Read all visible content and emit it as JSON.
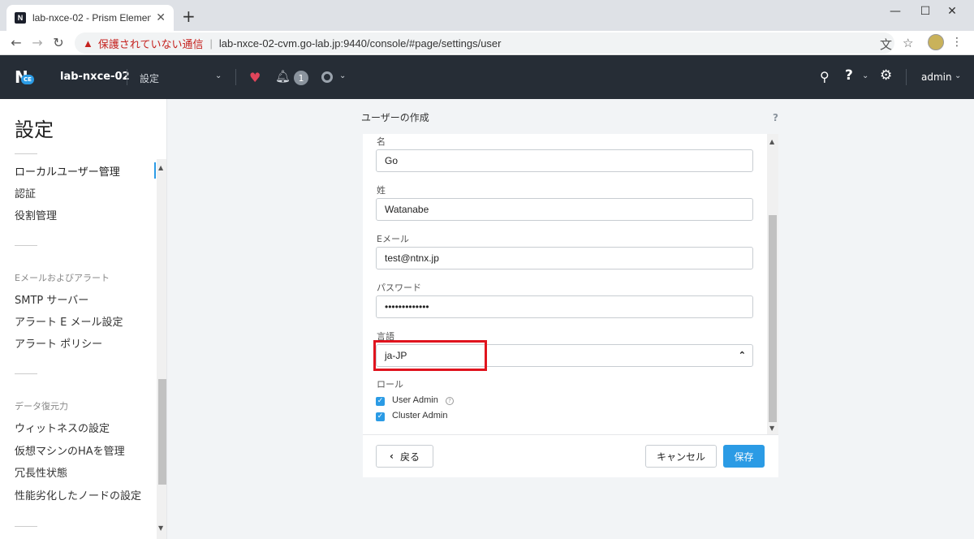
{
  "browser": {
    "tab_title": "lab-nxce-02 - Prism Element",
    "tab_favicon": "N",
    "new_tab": "+",
    "close_tab": "✕",
    "minimize": "—",
    "maximize": "☐",
    "close_window": "✕",
    "back": "←",
    "forward": "→",
    "reload": "↻",
    "security_warning": "保護されていない通信",
    "url": "lab-nxce-02-cvm.go-lab.jp:9440/console/#page/settings/user",
    "icons": [
      "translate-icon",
      "star-icon",
      "profile-icon",
      "menu-icon"
    ]
  },
  "header": {
    "logo_text": "N",
    "logo_badge": "CE",
    "cluster": "lab-nxce-02",
    "page": "設定",
    "alerts_count": "1",
    "user": "admin"
  },
  "sidebar": {
    "title": "設定",
    "items_group1": [
      "ローカルユーザー管理",
      "認証",
      "役割管理"
    ],
    "heading_email": "Eメールおよびアラート",
    "items_group2": [
      "SMTP サーバー",
      "アラート E メール設定",
      "アラート ポリシー"
    ],
    "heading_data": "データ復元力",
    "items_group3": [
      "ウィットネスの設定",
      "仮想マシンのHAを管理",
      "冗長性状態",
      "性能劣化したノードの設定"
    ]
  },
  "dialog": {
    "title": "ユーザーの作成",
    "help": "?",
    "first_name_label": "名",
    "first_name_value": "Go",
    "last_name_label": "姓",
    "last_name_value": "Watanabe",
    "email_label": "Eメール",
    "email_value": "test@ntnx.jp",
    "password_label": "パスワード",
    "password_value": "•••••••••••••",
    "language_label": "言語",
    "language_value": "ja-JP",
    "roles_label": "ロール",
    "role_user_admin": "User Admin",
    "role_cluster_admin": "Cluster Admin",
    "back_button": "戻る",
    "cancel_button": "キャンセル",
    "save_button": "保存"
  },
  "colors": {
    "accent": "#2b9be5",
    "header_bg": "#262d36",
    "highlight": "#e0141e",
    "warning": "#c5221f"
  }
}
